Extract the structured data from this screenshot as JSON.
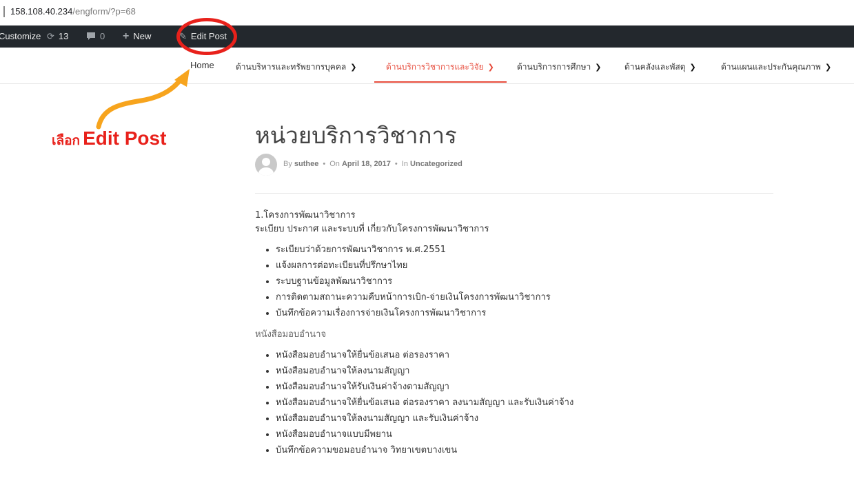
{
  "address_bar": {
    "host": "158.108.40.234",
    "path": "/engform/?p=68"
  },
  "admin_bar": {
    "customize": "Customize",
    "updates_count": "13",
    "comments_count": "0",
    "new_label": "New",
    "edit_post": "Edit Post"
  },
  "nav": {
    "items": [
      {
        "label": "Home"
      },
      {
        "label": "ด้านบริหารและทรัพยากรบุคคล"
      },
      {
        "label": "ด้านบริการวิชาการและวิจัย"
      },
      {
        "label": "ด้านบริการการศึกษา"
      },
      {
        "label": "ด้านคลังและพัสดุ"
      },
      {
        "label": "ด้านแผนและประกันคุณภาพ"
      }
    ],
    "active_index": 2
  },
  "annotation": {
    "prefix": "เลือก",
    "target": "Edit Post"
  },
  "post": {
    "title": "หน่วยบริการวิชาการ",
    "author_prefix": "By",
    "author": "suthee",
    "date_prefix": "On",
    "date": "April 18, 2017",
    "category_prefix": "In",
    "category": "Uncategorized",
    "section1_heading": "1.โครงการพัฒนาวิชาการ",
    "section1_sub": "ระเบียบ ประกาศ และระบบที่ เกี่ยวกับโครงการพัฒนาวิชาการ",
    "section1_items": [
      "ระเบียบว่าด้วยการพัฒนาวิชาการ พ.ศ.2551",
      "แจ้งผลการต่อทะเบียนที่ปรึกษาไทย",
      "ระบบฐานข้อมูลพัฒนาวิชาการ",
      "การติดตามสถานะความคืบหน้าการเบิก-จ่ายเงินโครงการพัฒนาวิชาการ",
      "บันทึกข้อความเรื่องการจ่ายเงินโครงการพัฒนาวิชาการ"
    ],
    "section2_heading": "หนังสือมอบอำนาจ",
    "section2_items": [
      "หนังสือมอบอำนาจให้ยื่นข้อเสนอ ต่อรองราคา",
      "หนังสือมอบอำนาจให้ลงนามสัญญา",
      "หนังสือมอบอำนาจให้รับเงินค่าจ้างตามสัญญา",
      "หนังสือมอบอำนาจให้ยื่นข้อเสนอ ต่อรองราคา ลงนามสัญญา และรับเงินค่าจ้าง",
      "หนังสือมอบอำนาจให้ลงนามสัญญา และรับเงินค่าจ้าง",
      "หนังสือมอบอำนาจแบบมีพยาน",
      "บันทึกข้อความขอมอบอำนาจ วิทยาเขตบางเขน"
    ]
  },
  "colors": {
    "accent": "#e74c3c",
    "annotation_red": "#e8211b",
    "arrow_orange": "#f7a41d",
    "admin_bar": "#23282d"
  }
}
